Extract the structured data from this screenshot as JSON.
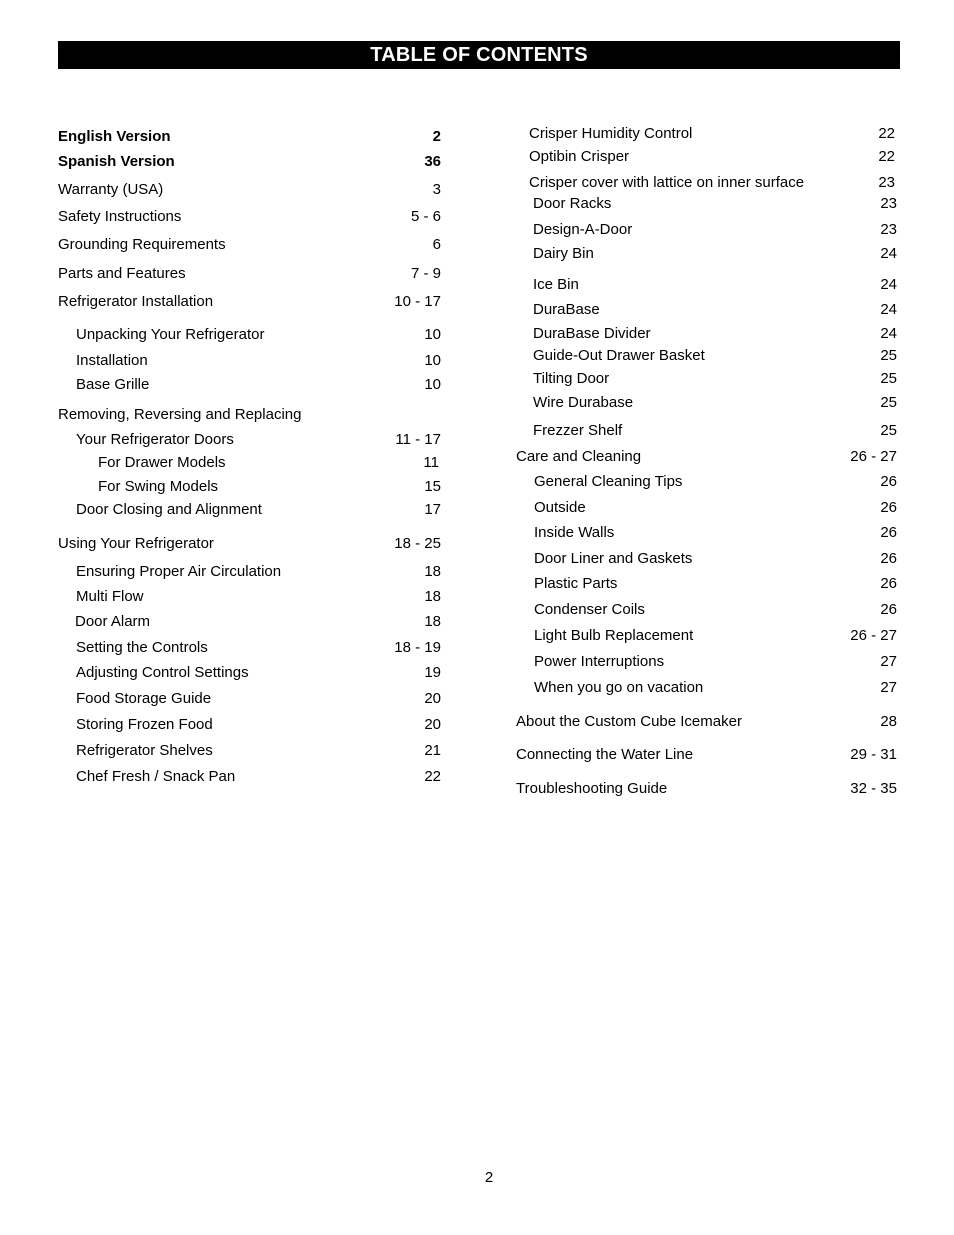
{
  "title": "TABLE OF CONTENTS",
  "page_number": "2",
  "left_column": [
    {
      "label": "English Version",
      "page": "2",
      "bold": true
    },
    {
      "label": "Spanish Version",
      "page": "36",
      "bold": true
    },
    {
      "label": "Warranty (USA)",
      "page": "3"
    },
    {
      "label": "Safety Instructions",
      "page": "5 - 6"
    },
    {
      "label": "Grounding Requirements",
      "page": "6"
    },
    {
      "label": "Parts and Features",
      "page": "7 - 9"
    },
    {
      "label": "Refrigerator Installation",
      "page": "10 - 17"
    },
    {
      "label": "Unpacking Your Refrigerator",
      "page": "10"
    },
    {
      "label": "Installation",
      "page": "10"
    },
    {
      "label": "Base Grille",
      "page": "10"
    },
    {
      "label": "Removing, Reversing and Replacing",
      "page": ""
    },
    {
      "label": "Your Refrigerator Doors",
      "page": "11 - 17"
    },
    {
      "label": "For Drawer Models",
      "page": "11"
    },
    {
      "label": "For Swing Models",
      "page": "15"
    },
    {
      "label": "Door Closing and Alignment",
      "page": "17"
    },
    {
      "label": "Using Your Refrigerator",
      "page": "18 - 25"
    },
    {
      "label": "Ensuring Proper Air Circulation",
      "page": "18"
    },
    {
      "label": "Multi Flow",
      "page": "18"
    },
    {
      "label": "Door Alarm",
      "page": "18"
    },
    {
      "label": "Setting the Controls",
      "page": "18 - 19"
    },
    {
      "label": "Adjusting Control Settings",
      "page": "19"
    },
    {
      "label": "Food Storage Guide",
      "page": "20"
    },
    {
      "label": "Storing Frozen Food",
      "page": "20"
    },
    {
      "label": "Refrigerator Shelves",
      "page": "21"
    },
    {
      "label": "Chef Fresh / Snack Pan",
      "page": "22"
    }
  ],
  "right_column": [
    {
      "label": "Crisper Humidity Control",
      "page": "22"
    },
    {
      "label": "Optibin Crisper",
      "page": "22"
    },
    {
      "label": "Crisper cover with lattice on inner surface",
      "page": "23"
    },
    {
      "label": "Door Racks",
      "page": "23"
    },
    {
      "label": "Design-A-Door",
      "page": "23"
    },
    {
      "label": "Dairy Bin",
      "page": "24"
    },
    {
      "label": "Ice Bin",
      "page": "24"
    },
    {
      "label": "DuraBase",
      "page": "24"
    },
    {
      "label": "DuraBase Divider",
      "page": "24"
    },
    {
      "label": "Guide-Out Drawer Basket",
      "page": "25"
    },
    {
      "label": "Tilting Door",
      "page": "25"
    },
    {
      "label": "Wire Durabase",
      "page": "25"
    },
    {
      "label": "Frezzer Shelf",
      "page": "25"
    },
    {
      "label": "Care and Cleaning",
      "page": "26 - 27"
    },
    {
      "label": "General Cleaning Tips",
      "page": "26"
    },
    {
      "label": "Outside",
      "page": "26"
    },
    {
      "label": "Inside Walls",
      "page": "26"
    },
    {
      "label": "Door Liner and Gaskets",
      "page": "26"
    },
    {
      "label": "Plastic Parts",
      "page": "26"
    },
    {
      "label": "Condenser Coils",
      "page": "26"
    },
    {
      "label": "Light Bulb Replacement",
      "page": "26 - 27"
    },
    {
      "label": "Power Interruptions",
      "page": "27"
    },
    {
      "label": "When you go on vacation",
      "page": "27"
    },
    {
      "label": "About the Custom Cube Icemaker",
      "page": "28"
    },
    {
      "label": "Connecting the Water Line",
      "page": "29 - 31"
    },
    {
      "label": "Troubleshooting Guide",
      "page": "32 - 35"
    }
  ]
}
